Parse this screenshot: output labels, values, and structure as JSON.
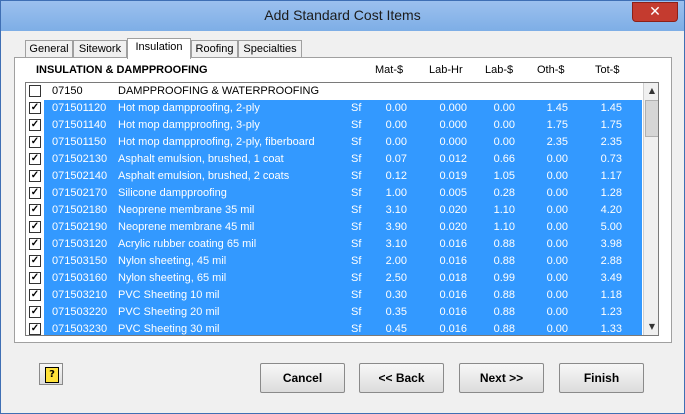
{
  "window": {
    "title": "Add Standard Cost Items",
    "close_icon": "close-icon"
  },
  "tabs": [
    {
      "label": "General"
    },
    {
      "label": "Sitework"
    },
    {
      "label": "Insulation",
      "active": true
    },
    {
      "label": "Roofing"
    },
    {
      "label": "Specialties"
    }
  ],
  "section": {
    "title": "INSULATION & DAMPPROOFING",
    "columns": [
      "Mat-$",
      "Lab-Hr",
      "Lab-$",
      "Oth-$",
      "Tot-$"
    ]
  },
  "rows": [
    {
      "code": "07150",
      "desc": "DAMPPROOFING & WATERPROOFING",
      "unit": "",
      "mat": "",
      "labhr": "",
      "lab": "",
      "oth": "",
      "tot": "",
      "checked": false,
      "selected": false
    },
    {
      "code": "071501120",
      "desc": "Hot mop dampproofing, 2-ply",
      "unit": "Sf",
      "mat": "0.00",
      "labhr": "0.000",
      "lab": "0.00",
      "oth": "1.45",
      "tot": "1.45",
      "checked": true,
      "selected": true
    },
    {
      "code": "071501140",
      "desc": "Hot mop dampproofing, 3-ply",
      "unit": "Sf",
      "mat": "0.00",
      "labhr": "0.000",
      "lab": "0.00",
      "oth": "1.75",
      "tot": "1.75",
      "checked": true,
      "selected": true
    },
    {
      "code": "071501150",
      "desc": "Hot mop dampproofing, 2-ply, fiberboard",
      "unit": "Sf",
      "mat": "0.00",
      "labhr": "0.000",
      "lab": "0.00",
      "oth": "2.35",
      "tot": "2.35",
      "checked": true,
      "selected": true
    },
    {
      "code": "071502130",
      "desc": "Asphalt emulsion, brushed, 1 coat",
      "unit": "Sf",
      "mat": "0.07",
      "labhr": "0.012",
      "lab": "0.66",
      "oth": "0.00",
      "tot": "0.73",
      "checked": true,
      "selected": true
    },
    {
      "code": "071502140",
      "desc": "Asphalt emulsion, brushed, 2 coats",
      "unit": "Sf",
      "mat": "0.12",
      "labhr": "0.019",
      "lab": "1.05",
      "oth": "0.00",
      "tot": "1.17",
      "checked": true,
      "selected": true
    },
    {
      "code": "071502170",
      "desc": "Silicone dampproofing",
      "unit": "Sf",
      "mat": "1.00",
      "labhr": "0.005",
      "lab": "0.28",
      "oth": "0.00",
      "tot": "1.28",
      "checked": true,
      "selected": true
    },
    {
      "code": "071502180",
      "desc": "Neoprene membrane 35 mil",
      "unit": "Sf",
      "mat": "3.10",
      "labhr": "0.020",
      "lab": "1.10",
      "oth": "0.00",
      "tot": "4.20",
      "checked": true,
      "selected": true
    },
    {
      "code": "071502190",
      "desc": "Neoprene membrane 45 mil",
      "unit": "Sf",
      "mat": "3.90",
      "labhr": "0.020",
      "lab": "1.10",
      "oth": "0.00",
      "tot": "5.00",
      "checked": true,
      "selected": true
    },
    {
      "code": "071503120",
      "desc": "Acrylic rubber coating 65 mil",
      "unit": "Sf",
      "mat": "3.10",
      "labhr": "0.016",
      "lab": "0.88",
      "oth": "0.00",
      "tot": "3.98",
      "checked": true,
      "selected": true
    },
    {
      "code": "071503150",
      "desc": "Nylon sheeting, 45 mil",
      "unit": "Sf",
      "mat": "2.00",
      "labhr": "0.016",
      "lab": "0.88",
      "oth": "0.00",
      "tot": "2.88",
      "checked": true,
      "selected": true
    },
    {
      "code": "071503160",
      "desc": "Nylon sheeting, 65 mil",
      "unit": "Sf",
      "mat": "2.50",
      "labhr": "0.018",
      "lab": "0.99",
      "oth": "0.00",
      "tot": "3.49",
      "checked": true,
      "selected": true
    },
    {
      "code": "071503210",
      "desc": "PVC Sheeting 10 mil",
      "unit": "Sf",
      "mat": "0.30",
      "labhr": "0.016",
      "lab": "0.88",
      "oth": "0.00",
      "tot": "1.18",
      "checked": true,
      "selected": true
    },
    {
      "code": "071503220",
      "desc": "PVC Sheeting 20 mil",
      "unit": "Sf",
      "mat": "0.35",
      "labhr": "0.016",
      "lab": "0.88",
      "oth": "0.00",
      "tot": "1.23",
      "checked": true,
      "selected": true
    },
    {
      "code": "071503230",
      "desc": "PVC Sheeting 30 mil",
      "unit": "Sf",
      "mat": "0.45",
      "labhr": "0.016",
      "lab": "0.88",
      "oth": "0.00",
      "tot": "1.33",
      "checked": true,
      "selected": true
    }
  ],
  "buttons": {
    "help_icon": "help-icon",
    "cancel": "Cancel",
    "back": "<< Back",
    "next": "Next >>",
    "finish": "Finish"
  },
  "colors": {
    "selection": "#3399ff",
    "titlebar": "#7eaee6"
  }
}
